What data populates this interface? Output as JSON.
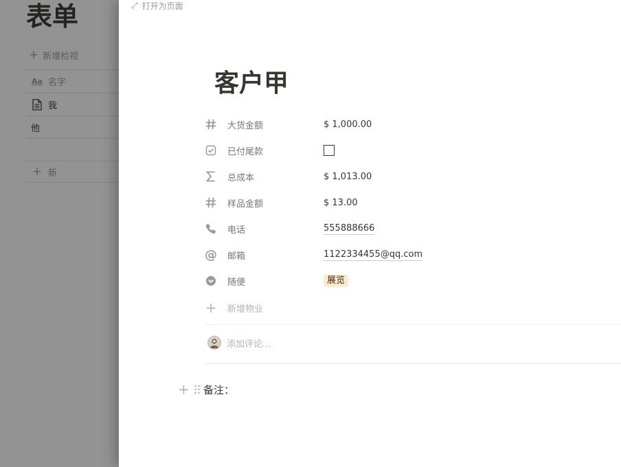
{
  "background": {
    "title": "表单",
    "add_view": "新增检视",
    "column_header": "名字",
    "rows": [
      "我",
      "他"
    ],
    "new_row": "新"
  },
  "peek": {
    "open_as_page": "打开为页面",
    "record_title": "客户甲",
    "properties": [
      {
        "icon": "number-icon",
        "name": "大货金额",
        "value": "$ 1,000.00"
      },
      {
        "icon": "checkbox-icon",
        "name": "已付尾款",
        "value": ""
      },
      {
        "icon": "sigma-icon",
        "name": "总成本",
        "value": "$ 1,013.00"
      },
      {
        "icon": "number-icon",
        "name": "样品金额",
        "value": "$ 13.00"
      },
      {
        "icon": "phone-icon",
        "name": "电话",
        "value": "555888666"
      },
      {
        "icon": "at-icon",
        "name": "邮箱",
        "value": "1122334455@qq.com"
      },
      {
        "icon": "select-icon",
        "name": "随便",
        "value": "展览"
      }
    ],
    "add_property": "新增物业",
    "comment_placeholder": "添加评论...",
    "block_text": "备注："
  },
  "colors": {
    "tag_bg": "#fbecd0",
    "overlay": "#0f0f0f",
    "text": "#37352f",
    "muted": "#9b9a97"
  }
}
